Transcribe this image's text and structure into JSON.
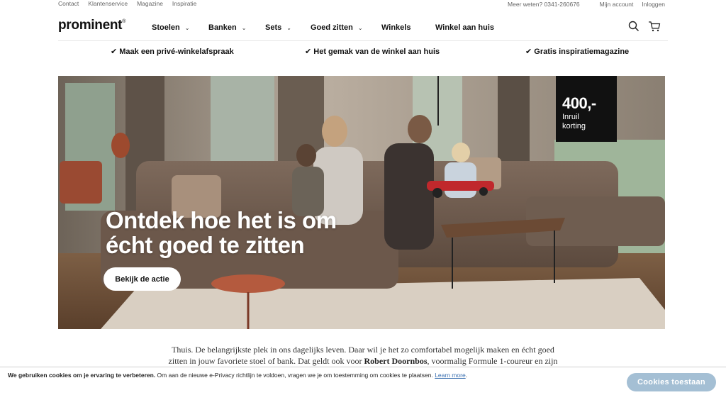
{
  "utility": {
    "links": [
      "Contact",
      "Klantenservice",
      "Magazine",
      "Inspiratie"
    ],
    "help_text": "Meer weten? 0341-260676",
    "account": "Mijn account",
    "login": "Inloggen"
  },
  "header": {
    "logo": "prominent",
    "logo_mark": "®",
    "nav": [
      {
        "label": "Stoelen",
        "has_dropdown": true
      },
      {
        "label": "Banken",
        "has_dropdown": true
      },
      {
        "label": "Sets",
        "has_dropdown": true
      },
      {
        "label": "Goed zitten",
        "has_dropdown": true
      },
      {
        "label": "Winkels",
        "has_dropdown": false
      },
      {
        "label": "Winkel aan huis",
        "has_dropdown": false
      }
    ],
    "icons": [
      "search-icon",
      "cart-icon"
    ]
  },
  "usps": [
    "✔ Maak een privé-winkelafspraak",
    "✔ Het gemak van de winkel aan huis",
    "✔ Gratis inspiratiemagazine"
  ],
  "hero": {
    "badge_amount": "400,-",
    "badge_line1": "Inruil",
    "badge_line2": "korting",
    "headline_line1": "Ontdek hoe het is om",
    "headline_line2": "écht goed te zitten",
    "cta": "Bekijk de actie"
  },
  "intro": {
    "line1": "Thuis. De belangrijkste plek in ons dagelijks leven. Daar wil je het zo comfortabel mogelijk maken en écht goed",
    "line2_start": "zitten in jouw favoriete stoel of bank. Dat geldt ook voor ",
    "line2_name": "Robert Doornbos",
    "line2_end": ", voormalig Formule 1-coureur en zijn"
  },
  "cookie": {
    "bold": "We gebruiken cookies om je ervaring te verbeteren.",
    "text": " Om aan de nieuwe e-Privacy richtlijn te voldoen, vragen we je om toestemming om cookies te plaatsen. ",
    "learn_more": "Learn more",
    "period": ".",
    "accept": "Cookies toestaan"
  },
  "colors": {
    "accept_button": "#a4bfd4",
    "badge_background": "#111111",
    "link": "#3a6fb0"
  }
}
